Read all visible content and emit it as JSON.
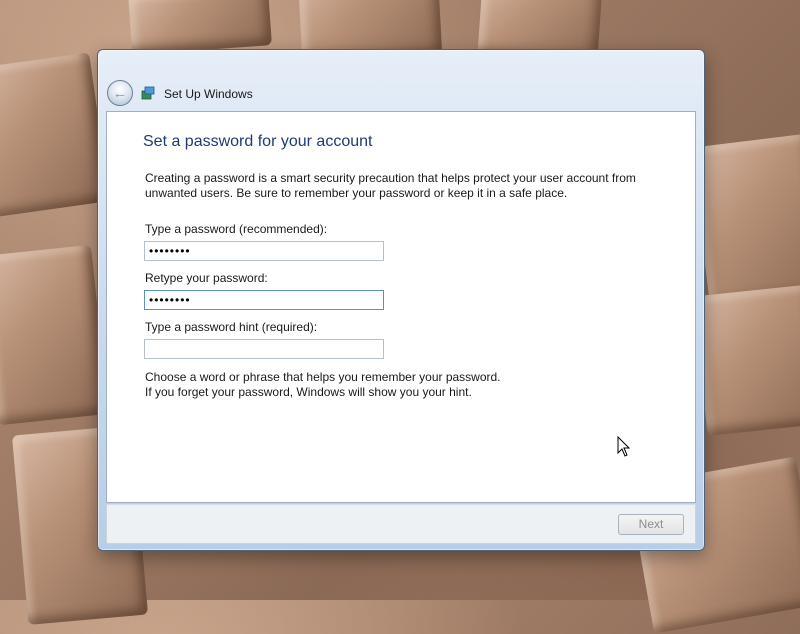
{
  "window": {
    "title": "Set Up Windows",
    "back_icon": "back-arrow-icon"
  },
  "page": {
    "heading": "Set a password for your account",
    "description_line1": "Creating a password is a smart security precaution that helps protect your user account from",
    "description_line2": "unwanted users. Be sure to remember your password or keep it in a safe place."
  },
  "form": {
    "password_label": "Type a password (recommended):",
    "password_value": "••••••••",
    "retype_label": "Retype your password:",
    "retype_value": "••••••••",
    "hint_label": "Type a password hint (required):",
    "hint_value": ""
  },
  "hint_text": {
    "line1": "Choose a word or phrase that helps you remember your password.",
    "line2": "If you forget your password, Windows will show you your hint."
  },
  "footer": {
    "next_label": "Next"
  },
  "colors": {
    "heading": "#1f3b73",
    "focus_border": "#5a8fc8"
  }
}
